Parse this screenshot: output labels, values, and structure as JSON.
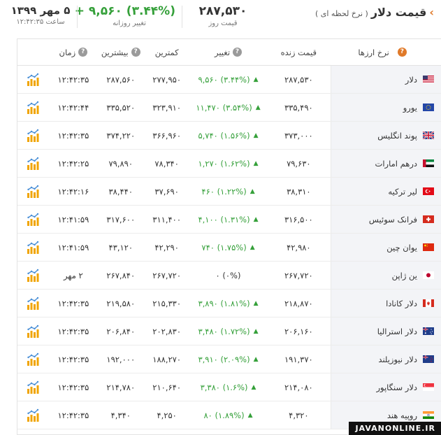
{
  "header": {
    "title": "قیمت دلار",
    "subtitle": "( نرخ لحظه ای )",
    "day_price": "۲۸۷,۵۳۰",
    "day_price_label": "قیمت روز",
    "daily_change": "(۳.۴۴%) ۹,۵۶۰",
    "daily_change_sign": "+",
    "daily_change_label": "تغییر روزانه",
    "date": "۵ مهر ۱۳۹۹",
    "time_label": "ساعت ۱۲:۴۲:۳۵",
    "accent_color": "#e07a2a",
    "positive_color": "#35a03a"
  },
  "columns": {
    "name": "نرخ ارزها",
    "price": "قیمت زنده",
    "change": "تغییر",
    "min": "کمترین",
    "max": "بیشترین",
    "time": "زمان"
  },
  "rows": [
    {
      "name": "دلار",
      "flag": "us",
      "price": "۲۸۷,۵۳۰",
      "change": "(۳.۴۴%) ۹,۵۶۰",
      "up": true,
      "min": "۲۷۷,۹۵۰",
      "max": "۲۸۷,۵۶۰",
      "time": "۱۲:۴۲:۳۵"
    },
    {
      "name": "یورو",
      "flag": "eu",
      "price": "۳۳۵,۴۹۰",
      "change": "(۳.۵۴%) ۱۱,۴۷۰",
      "up": true,
      "min": "۳۲۳,۹۱۰",
      "max": "۳۳۵,۵۲۰",
      "time": "۱۲:۴۲:۴۴"
    },
    {
      "name": "پوند انگلیس",
      "flag": "gb",
      "price": "۳۷۳,۰۰۰",
      "change": "(۱.۵۶%) ۵,۷۴۰",
      "up": true,
      "min": "۳۶۶,۹۶۰",
      "max": "۳۷۴,۲۲۰",
      "time": "۱۲:۴۲:۳۵"
    },
    {
      "name": "درهم امارات",
      "flag": "ae",
      "price": "۷۹,۶۳۰",
      "change": "(۱.۶۲%) ۱,۲۷۰",
      "up": true,
      "min": "۷۸,۳۴۰",
      "max": "۷۹,۸۹۰",
      "time": "۱۲:۴۲:۲۵"
    },
    {
      "name": "لیر ترکیه",
      "flag": "tr",
      "price": "۳۸,۳۱۰",
      "change": "(۱.۲۲%) ۴۶۰",
      "up": true,
      "min": "۳۷,۶۹۰",
      "max": "۳۸,۴۴۰",
      "time": "۱۲:۴۲:۱۶"
    },
    {
      "name": "فرانک سوئیس",
      "flag": "ch",
      "price": "۳۱۶,۵۰۰",
      "change": "(۱.۳۱%) ۴,۱۰۰",
      "up": true,
      "min": "۳۱۱,۴۰۰",
      "max": "۳۱۷,۶۰۰",
      "time": "۱۲:۴۱:۵۹"
    },
    {
      "name": "یوان چین",
      "flag": "cn",
      "price": "۴۲,۹۸۰",
      "change": "(۱.۷۵%) ۷۴۰",
      "up": true,
      "min": "۴۲,۲۹۰",
      "max": "۴۳,۱۲۰",
      "time": "۱۲:۴۱:۵۹"
    },
    {
      "name": "ین ژاپن",
      "flag": "jp",
      "price": "۲۶۷,۷۲۰",
      "change": "(۰%) ۰",
      "up": false,
      "min": "۲۶۷,۷۲۰",
      "max": "۲۶۷,۸۴۰",
      "time": "۲ مهر"
    },
    {
      "name": "دلار کانادا",
      "flag": "ca",
      "price": "۲۱۸,۸۷۰",
      "change": "(۱.۸۱%) ۳,۸۹۰",
      "up": true,
      "min": "۲۱۵,۳۳۰",
      "max": "۲۱۹,۵۸۰",
      "time": "۱۲:۴۲:۳۵"
    },
    {
      "name": "دلار استرالیا",
      "flag": "au",
      "price": "۲۰۶,۱۶۰",
      "change": "(۱.۷۲%) ۳,۴۸۰",
      "up": true,
      "min": "۲۰۲,۸۳۰",
      "max": "۲۰۶,۸۴۰",
      "time": "۱۲:۴۲:۳۵"
    },
    {
      "name": "دلار نیوزیلند",
      "flag": "nz",
      "price": "۱۹۱,۳۷۰",
      "change": "(۲.۰۹%) ۳,۹۱۰",
      "up": true,
      "min": "۱۸۸,۲۷۰",
      "max": "۱۹۲,۰۰۰",
      "time": "۱۲:۴۲:۳۵"
    },
    {
      "name": "دلار سنگاپور",
      "flag": "sg",
      "price": "۲۱۴,۰۸۰",
      "change": "(۱.۶%) ۳,۳۸۰",
      "up": true,
      "min": "۲۱۰,۶۴۰",
      "max": "۲۱۴,۷۸۰",
      "time": "۱۲:۴۲:۳۵"
    },
    {
      "name": "روپیه هند",
      "flag": "in",
      "price": "۴,۳۲۰",
      "change": "(۱.۸۹%) ۸۰",
      "up": true,
      "min": "۴,۲۵۰",
      "max": "۴,۳۴۰",
      "time": "۱۲:۴۲:۳۵"
    }
  ],
  "watermark": "JAVANONLINE.IR"
}
